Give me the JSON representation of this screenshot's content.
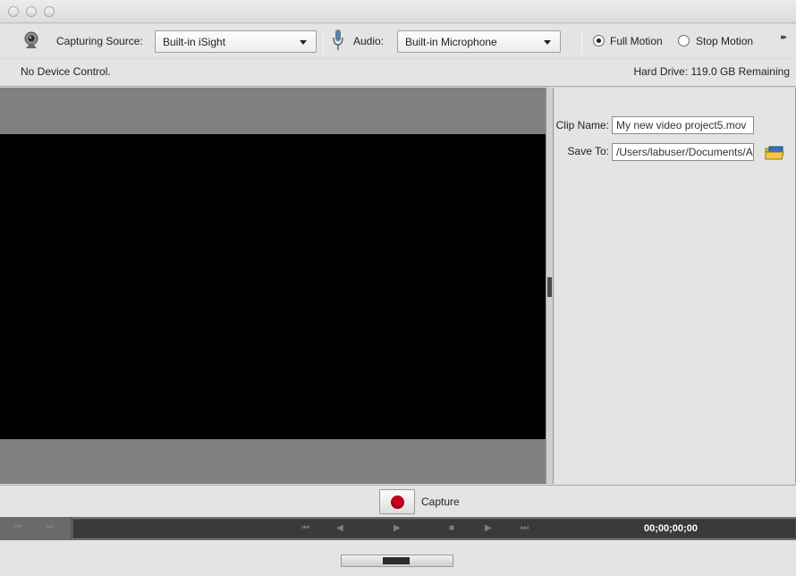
{
  "toolbar": {
    "capturing_source_label": "Capturing Source:",
    "capturing_source_value": "Built-in iSight",
    "audio_label": "Audio:",
    "audio_value": "Built-in Microphone",
    "full_motion_label": "Full Motion",
    "full_motion_selected": true,
    "stop_motion_label": "Stop Motion",
    "stop_motion_selected": false,
    "overflow_glyph": "▸▸"
  },
  "status": {
    "device_control": "No Device Control.",
    "hard_drive": "Hard Drive: 119.0 GB Remaining"
  },
  "panel": {
    "clip_name_label": "Clip Name:",
    "clip_name_value": "My new video project5.mov",
    "save_to_label": "Save To:",
    "save_to_value": "/Users/labuser/Documents/A"
  },
  "capture": {
    "label": "Capture",
    "record_color": "#c8001c"
  },
  "transport": {
    "timecode": "00;00;00;00"
  },
  "icons": {
    "webcam": "webcam-icon",
    "microphone": "microphone-icon",
    "folder": "folder-icon"
  }
}
